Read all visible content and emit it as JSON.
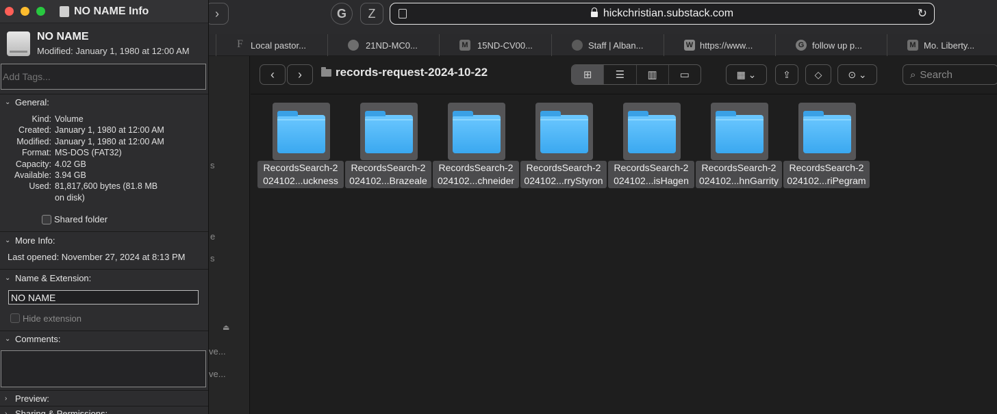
{
  "browser": {
    "g_button": "G",
    "z_button": "Z",
    "url": "hickchristian.substack.com",
    "forward_label": "›",
    "tabs": [
      {
        "favicon": "F",
        "label": "Local pastor..."
      },
      {
        "favicon": "",
        "label": "21ND-MC0..."
      },
      {
        "favicon": "M",
        "label": "15ND-CV00..."
      },
      {
        "favicon": "",
        "label": "Staff | Alban..."
      },
      {
        "favicon": "W",
        "label": "https://www..."
      },
      {
        "favicon": "G",
        "label": "follow up p..."
      },
      {
        "favicon": "M",
        "label": "Mo. Liberty..."
      }
    ]
  },
  "finder": {
    "folder_title": "records-request-2024-10-22",
    "search_placeholder": "Search",
    "sidebar_fragments": [
      "s",
      "e",
      "s",
      "ve...",
      "ve..."
    ],
    "items": [
      {
        "line1": "RecordsSearch-2",
        "line2": "024102...uckness"
      },
      {
        "line1": "RecordsSearch-2",
        "line2": "024102...Brazeale"
      },
      {
        "line1": "RecordsSearch-2",
        "line2": "024102...chneider"
      },
      {
        "line1": "RecordsSearch-2",
        "line2": "024102...rryStyron"
      },
      {
        "line1": "RecordsSearch-2",
        "line2": "024102...isHagen"
      },
      {
        "line1": "RecordsSearch-2",
        "line2": "024102...hnGarrity"
      },
      {
        "line1": "RecordsSearch-2",
        "line2": "024102...riPegram"
      }
    ]
  },
  "info": {
    "window_title": "NO NAME Info",
    "drive_name": "NO NAME",
    "modified_line": "Modified: January 1, 1980 at 12:00 AM",
    "tags_placeholder": "Add Tags...",
    "general": {
      "header": "General:",
      "rows": [
        {
          "k": "Kind:",
          "v": "Volume"
        },
        {
          "k": "Created:",
          "v": "January 1, 1980 at 12:00 AM"
        },
        {
          "k": "Modified:",
          "v": "January 1, 1980 at 12:00 AM"
        },
        {
          "k": "Format:",
          "v": "MS-DOS (FAT32)"
        },
        {
          "k": "Capacity:",
          "v": "4.02 GB"
        },
        {
          "k": "Available:",
          "v": "3.94 GB"
        },
        {
          "k": "Used:",
          "v": "81,817,600 bytes (81.8 MB"
        },
        {
          "k": "",
          "v": "on disk)"
        }
      ],
      "shared_folder": "Shared folder"
    },
    "more_info": {
      "header": "More Info:",
      "last_opened": "Last opened: November 27, 2024 at 8:13 PM"
    },
    "name_ext": {
      "header": "Name & Extension:",
      "name_value": "NO NAME",
      "hide_extension": "Hide extension"
    },
    "comments": {
      "header": "Comments:"
    },
    "preview": {
      "header": "Preview:"
    },
    "sharing": {
      "header": "Sharing & Permissions:"
    }
  }
}
